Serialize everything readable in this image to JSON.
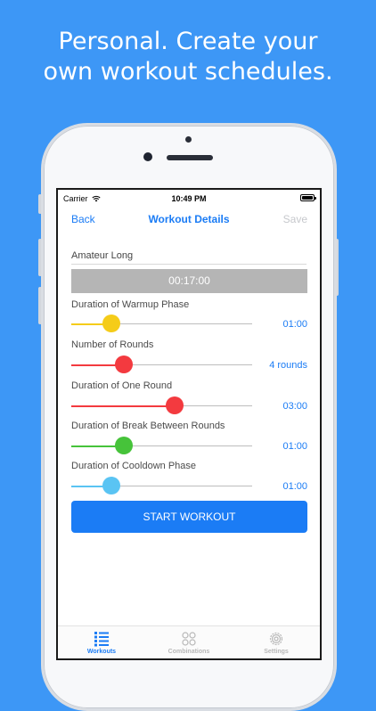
{
  "headline": {
    "line1": "Personal. Create your",
    "line2": "own workout schedules."
  },
  "status_bar": {
    "carrier": "Carrier",
    "time": "10:49 PM"
  },
  "nav": {
    "back_label": "Back",
    "title": "Workout Details",
    "save_label": "Save"
  },
  "workout": {
    "name": "Amateur Long",
    "total_duration": "00:17:00",
    "start_label": "START WORKOUT"
  },
  "sliders": [
    {
      "label": "Duration of Warmup Phase",
      "value": "01:00",
      "fraction": 0.22,
      "color": "#f5cc19"
    },
    {
      "label": "Number of Rounds",
      "value": "4 rounds",
      "fraction": 0.29,
      "color": "#f33a3f"
    },
    {
      "label": "Duration of One Round",
      "value": "03:00",
      "fraction": 0.57,
      "color": "#f33a3f"
    },
    {
      "label": "Duration of Break Between Rounds",
      "value": "01:00",
      "fraction": 0.29,
      "color": "#46c33a"
    },
    {
      "label": "Duration of Cooldown Phase",
      "value": "01:00",
      "fraction": 0.22,
      "color": "#5ac4f3"
    }
  ],
  "tabs": [
    {
      "label": "Workouts",
      "icon": "list-icon",
      "active": true
    },
    {
      "label": "Combinations",
      "icon": "combinations-icon",
      "active": false
    },
    {
      "label": "Settings",
      "icon": "gear-icon",
      "active": false
    }
  ],
  "colors": {
    "background": "#3d97f6",
    "accent": "#1b7cf5",
    "inactive_tab": "#b8b8b8"
  }
}
